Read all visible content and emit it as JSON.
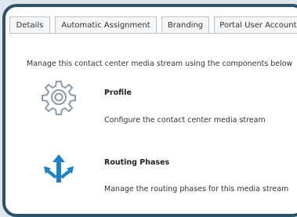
{
  "tabs": [
    {
      "label": "Details"
    },
    {
      "label": "Automatic Assignment"
    },
    {
      "label": "Branding"
    },
    {
      "label": "Portal User Accounts"
    }
  ],
  "intro_text": "Manage this contact center media stream using the components below",
  "components": [
    {
      "title": "Profile",
      "description": "Configure the contact center media stream",
      "icon": "gear-icon"
    },
    {
      "title": "Routing Phases",
      "description": "Manage the routing phases for this media stream",
      "icon": "routing-arrows-icon"
    }
  ],
  "colors": {
    "frame_border": "#2f5268",
    "routing_icon": "#1f82c6",
    "gear_icon": "#8f9aa8"
  }
}
